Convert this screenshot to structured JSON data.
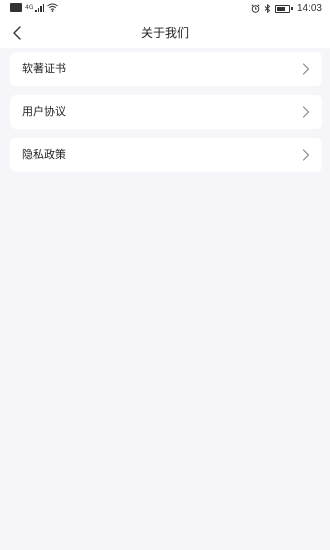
{
  "status_bar": {
    "network_label": "4G",
    "time": "14:03",
    "icons": [
      "sim-icon",
      "signal-icon",
      "wifi-icon",
      "alarm-icon",
      "bluetooth-icon",
      "battery-icon"
    ]
  },
  "header": {
    "title": "关于我们",
    "back_icon": "chevron-left-icon"
  },
  "menu": {
    "items": [
      {
        "label": "软著证书",
        "icon": "chevron-right-icon"
      },
      {
        "label": "用户协议",
        "icon": "chevron-right-icon"
      },
      {
        "label": "隐私政策",
        "icon": "chevron-right-icon"
      }
    ]
  },
  "colors": {
    "page_background": "#f5f5fa",
    "card_background": "#ffffff",
    "text": "#222222",
    "arrow": "#888888"
  }
}
